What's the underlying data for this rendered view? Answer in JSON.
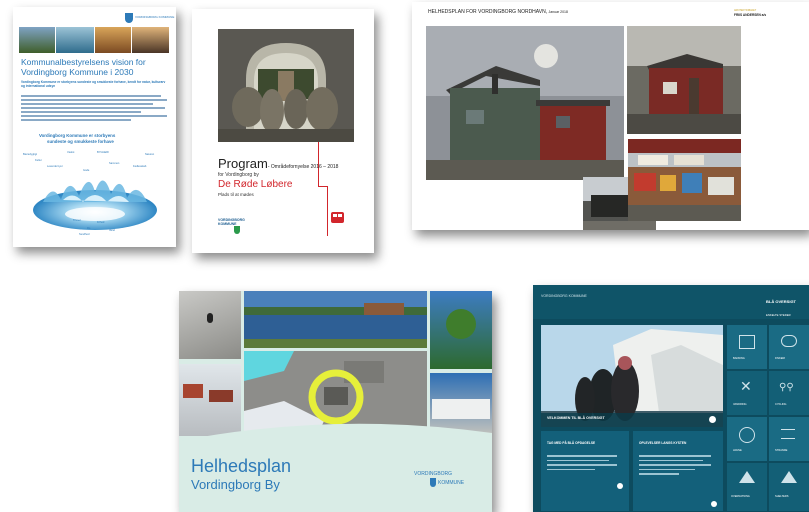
{
  "doc1": {
    "logo_text": "VORDINGBORG KOMMUNE",
    "title_line1": "Kommunalbestyrelsens vision for",
    "title_line2": "Vordingborg Kommune i 2030",
    "subtitle": "Vordingborg Kommune er storbyens sundeste og smukkeste forhave, kendt for natur, kulturarv og international udsyn",
    "vision_line1": "Vordingborg Kommune er storbyens",
    "vision_line2": "sundeste og smukkeste forhave",
    "words": [
      "Bæredygtigt",
      "Vækst",
      "BYGGERI",
      "Naturen",
      "Kultur",
      "Levende byer",
      "Sammen",
      "Fællesskab",
      "Gode",
      "Trivsel",
      "Frihed",
      "Ro",
      "Sundhed",
      "Vand"
    ]
  },
  "doc2": {
    "program_title": "Program",
    "program_suffix": "- Områdefornyelse 2016 – 2018",
    "for_text": "for Vordingborg by",
    "red_title": "De Røde Løbere",
    "sub_text": "Plads til at mødes",
    "logo_text": "VORDINGBORG KOMMUNE"
  },
  "doc3": {
    "title": "HELHEDSPLAN FOR VORDINGBORG NORDHAVN,",
    "date": "Januar 2018",
    "firm_label": "ARKITEKTFIRMAET",
    "firm_name": "FRIIS ANDERSEN a/s"
  },
  "doc4": {
    "title": "Helhedsplan",
    "subtitle": "Vordingborg By",
    "logo_line1": "VORDINGBORG",
    "logo_line2": "KOMMUNE"
  },
  "doc5": {
    "logo_text": "VORDINGBORG KOMMUNE",
    "brand": "BLÅ OVERSIGT",
    "subtitle": "ENKELTE STEDER",
    "hero_caption": "VELKOMMEN TIL BLÅ OVERSIGT",
    "box1_title": "TAG MED PÅ BLÅ OPDAGELSE",
    "box2_title": "OPLEVELSER LANGS KYSTEN",
    "grid": [
      "BADNING",
      "FISKERI",
      "VANDRING",
      "CYKLING",
      "HAVNE",
      "STRANDE",
      "OVERNATNING",
      "SHELTERS"
    ]
  },
  "colors": {
    "accent_blue": "#2d7ab8",
    "red": "#d2262c",
    "teal_dark": "#0d4b5e",
    "mint": "#d9ece6"
  }
}
